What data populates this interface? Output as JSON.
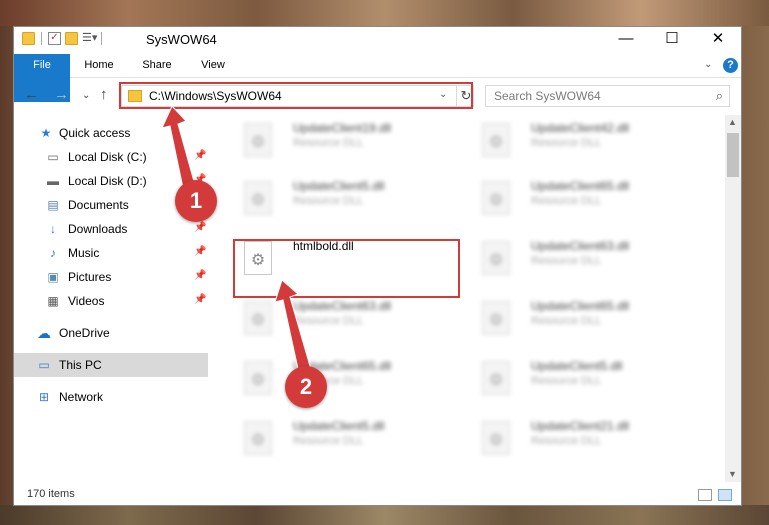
{
  "window": {
    "title": "SysWOW64"
  },
  "ribbon": {
    "tabs": [
      "File",
      "Home",
      "Share",
      "View"
    ]
  },
  "address": {
    "path": "C:\\Windows\\SysWOW64"
  },
  "search": {
    "placeholder": "Search SysWOW64"
  },
  "sidebar": {
    "items": [
      {
        "label": "Quick access"
      },
      {
        "label": "Local Disk (C:)"
      },
      {
        "label": "Local Disk (D:)"
      },
      {
        "label": "Documents"
      },
      {
        "label": "Downloads"
      },
      {
        "label": "Music"
      },
      {
        "label": "Pictures"
      },
      {
        "label": "Videos"
      },
      {
        "label": "OneDrive"
      },
      {
        "label": "This PC"
      },
      {
        "label": "Network"
      }
    ]
  },
  "files": {
    "left": [
      {
        "name": "UpdateClient19.dll",
        "type": "Resource DLL"
      },
      {
        "name": "UpdateClient5.dll",
        "type": "Resource DLL"
      },
      {
        "name": "htmlbold.dll",
        "type": ""
      },
      {
        "name": "UpdateClient63.dll",
        "type": "Resource DLL"
      },
      {
        "name": "UpdateClient65.dll",
        "type": "Resource DLL"
      },
      {
        "name": "UpdateClient5.dll",
        "type": "Resource DLL"
      }
    ],
    "right": [
      {
        "name": "UpdateClient42.dll",
        "type": "Resource DLL"
      },
      {
        "name": "UpdateClient65.dll",
        "type": "Resource DLL"
      },
      {
        "name": "UpdateClient63.dll",
        "type": "Resource DLL"
      },
      {
        "name": "UpdateClient65.dll",
        "type": "Resource DLL"
      },
      {
        "name": "UpdateClient5.dll",
        "type": "Resource DLL"
      },
      {
        "name": "UpdateClient21.dll",
        "type": "Resource DLL"
      }
    ]
  },
  "status": {
    "count": "170 items"
  },
  "annotations": {
    "badge1": "1",
    "badge2": "2",
    "color": "#d33b3b"
  }
}
